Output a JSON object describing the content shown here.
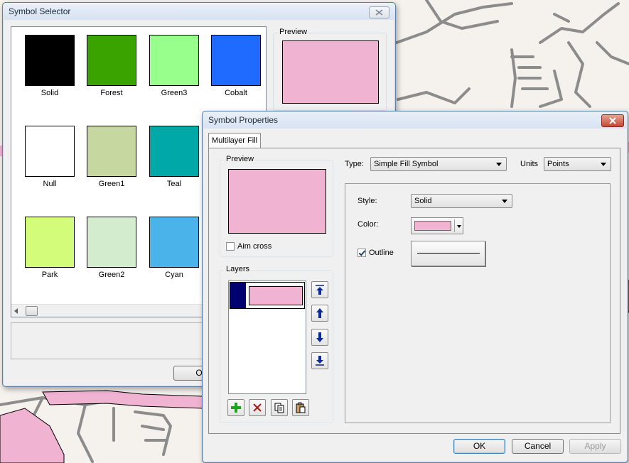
{
  "symbol_selector": {
    "title": "Symbol Selector",
    "preview_label": "Preview",
    "preview_color": "#f0b3d2",
    "ok_label": "OK",
    "swatches": [
      {
        "name": "Solid",
        "color": "#000000"
      },
      {
        "name": "Forest",
        "color": "#3aa300"
      },
      {
        "name": "Green3",
        "color": "#98fe8c"
      },
      {
        "name": "Cobalt",
        "color": "#1f6bff"
      },
      {
        "name": "Null",
        "color": "#ffffff"
      },
      {
        "name": "Green1",
        "color": "#c6d8a0"
      },
      {
        "name": "Teal",
        "color": "#00a8a8"
      },
      {
        "name": "Park",
        "color": "#d2fc79"
      },
      {
        "name": "Green2",
        "color": "#d3ecce"
      },
      {
        "name": "Cyan",
        "color": "#4ab4ea"
      }
    ]
  },
  "symbol_properties": {
    "title": "Symbol Properties",
    "tab_label": "Multilayer Fill",
    "preview_label": "Preview",
    "preview_color": "#f0b3d2",
    "aim_cross_label": "Aim cross",
    "layers_label": "Layers",
    "type_label": "Type:",
    "type_value": "Simple Fill Symbol",
    "units_label": "Units",
    "units_value": "Points",
    "style_label": "Style:",
    "style_value": "Solid",
    "color_label": "Color:",
    "fill_color": "#f0b3d2",
    "outline_label": "Outline",
    "ok_label": "OK",
    "cancel_label": "Cancel",
    "apply_label": "Apply"
  }
}
